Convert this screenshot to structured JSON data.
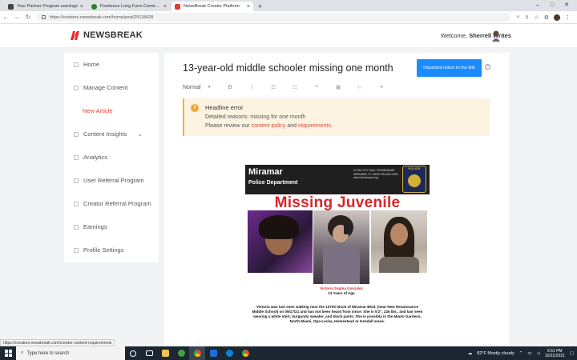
{
  "browser": {
    "tabs": [
      {
        "title": "Your Partner Program earnings",
        "color": "#444444",
        "active": false
      },
      {
        "title": "Freelance Long Form Content | ...",
        "color": "#2e7d32",
        "active": false
      },
      {
        "title": "NewsBreak Creator Platform",
        "color": "#e53935",
        "active": true
      }
    ],
    "url": "https://creators.newsbreak.com/home/post/25118428"
  },
  "header": {
    "logo": "NEWSBREAK",
    "welcome_prefix": "Welcome,",
    "user_name": "Sherrell Writes"
  },
  "sidebar": {
    "items": [
      {
        "label": "Home"
      },
      {
        "label": "Manage Content"
      },
      {
        "label": "New Article"
      },
      {
        "label": "Content Insights"
      },
      {
        "label": "Analytics"
      },
      {
        "label": "User Referral Program"
      },
      {
        "label": "Creator Referral Program"
      },
      {
        "label": "Earnings"
      },
      {
        "label": "Profile Settings"
      }
    ]
  },
  "editor": {
    "title": "13-year-old middle schooler missing one month",
    "notice_button": "Important notice to the title",
    "format_select": "Normal",
    "warning": {
      "heading": "Headline error",
      "detail": "Detailed reasons: missing for one month",
      "review_prefix": "Please review our",
      "policy_link": "content policy",
      "and": "and",
      "requirements_link": "requirements",
      "end": "."
    }
  },
  "flyer": {
    "city": "Miramar",
    "dept": "Police Department",
    "address": "11765 CITY HALL PROMENADE MIRAMAR, FL 33025 954-602-4000 www.miramarpd.org",
    "badge": "POLICE",
    "headline": "Missing Juvenile",
    "name": "Victoria Sophia Gonzalez",
    "age": "13 Years of Age",
    "description": "Victoria was last seen walking near the 10700 block of Miramar Blvd. (near New Renaissance Middle School) on 09/17/21 and has not been heard from since. She is 5'2\", 226 lbs., and last seen wearing a white shirt, burgundy sweater, and black pants. She is possibly in the Miami Gardens, North Miami, Opa-Locka, Homestead or Kendall areas."
  },
  "status_url": "https://creators.newsbreak.com/creator-content-requirements",
  "taskbar": {
    "search_placeholder": "Type here to search",
    "weather": "82°F Mostly cloudy",
    "time": "6:51 PM",
    "date": "10/21/2021"
  }
}
